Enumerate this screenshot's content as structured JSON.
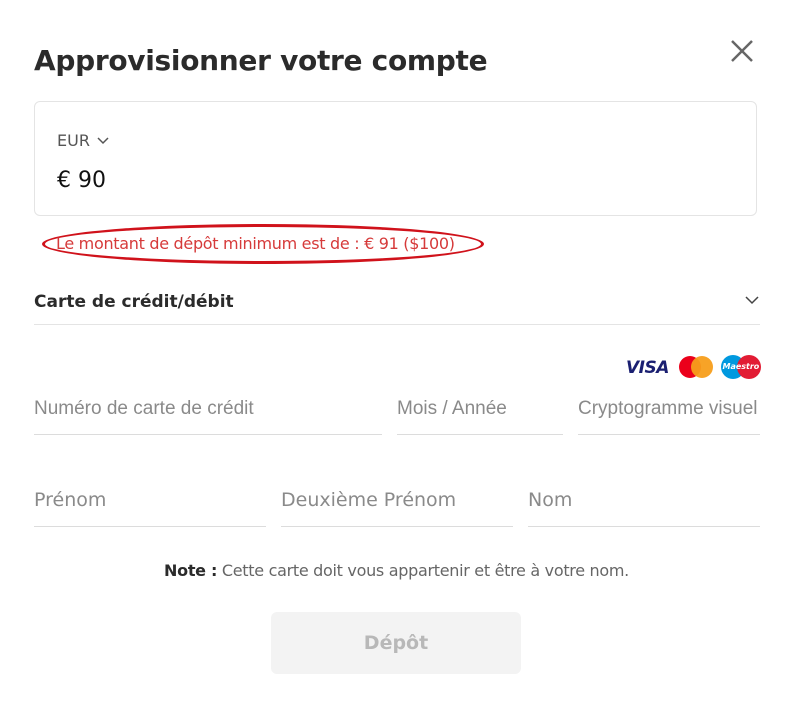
{
  "modal": {
    "title": "Approvisionner votre compte"
  },
  "amount": {
    "currency": "EUR",
    "value": "€ 90"
  },
  "error": {
    "message": "Le montant de dépôt minimum est de : € 91 ($100)"
  },
  "payment_method": {
    "label": "Carte de crédit/débit"
  },
  "card_logos": {
    "visa": "VISA",
    "maestro": "Maestro"
  },
  "fields": {
    "card_number": "Numéro de carte de crédit",
    "expiry": "Mois / Année",
    "cvv": "Cryptogramme visuel",
    "first_name": "Prénom",
    "middle_name": "Deuxième Prénom",
    "last_name": "Nom"
  },
  "note": {
    "label": "Note :",
    "text": " Cette carte doit vous appartenir et être à votre nom."
  },
  "actions": {
    "deposit": "Dépôt"
  },
  "colors": {
    "error": "#d63a3a",
    "error_outline": "#d0121b",
    "button_bg": "#f3f3f3",
    "button_text": "#b8b8b8"
  }
}
